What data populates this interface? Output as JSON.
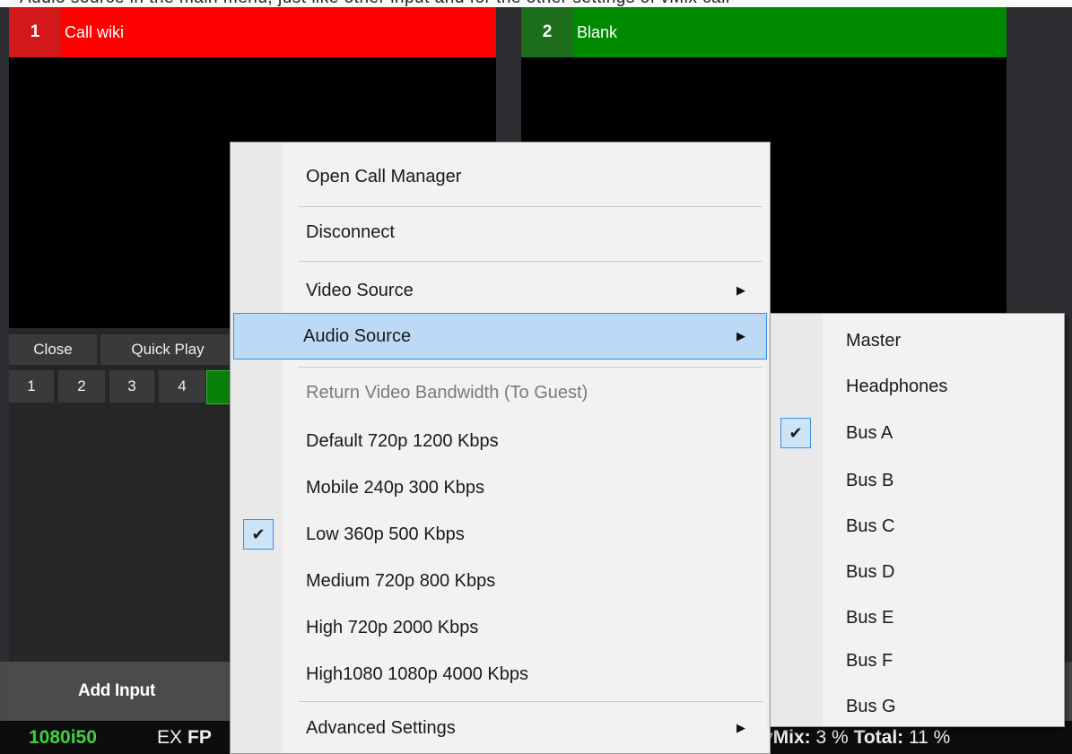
{
  "top_strip_text": "Audio source in the main menu, just like other input and for the other settings of vMix call",
  "panels": [
    {
      "number": "1",
      "title": "Call wiki",
      "color": "#fe0000"
    },
    {
      "number": "2",
      "title": "Blank",
      "color": "#008a00"
    }
  ],
  "controls": {
    "close": "Close",
    "quick_play": "Quick Play",
    "numbers": [
      "1",
      "2",
      "3",
      "4"
    ]
  },
  "bottom": {
    "add_input": "Add Input",
    "resolution": "1080i50",
    "ex": "EX",
    "fps_label": "FP",
    "vmix_label": "vMix:",
    "vmix_value": "3 %",
    "total_label": "Total:",
    "total_value": "11 %"
  },
  "context_menu": {
    "items": [
      {
        "label": "Open Call Manager"
      },
      {
        "label": "Disconnect"
      },
      {
        "label": "Video Source",
        "submenu": true
      },
      {
        "label": "Audio Source",
        "submenu": true,
        "highlighted": true
      },
      {
        "label": "Return Video Bandwidth (To Guest)",
        "disabled": true
      },
      {
        "label": "Default 720p 1200 Kbps"
      },
      {
        "label": "Mobile 240p 300 Kbps"
      },
      {
        "label": "Low 360p 500 Kbps",
        "checked": true
      },
      {
        "label": "Medium 720p 800 Kbps"
      },
      {
        "label": "High 720p 2000 Kbps"
      },
      {
        "label": "High1080 1080p 4000 Kbps"
      },
      {
        "label": "Advanced Settings",
        "submenu": true
      }
    ]
  },
  "audio_submenu": {
    "items": [
      {
        "label": "Master"
      },
      {
        "label": "Headphones"
      },
      {
        "label": "Bus A",
        "checked": true
      },
      {
        "label": "Bus B"
      },
      {
        "label": "Bus C"
      },
      {
        "label": "Bus D"
      },
      {
        "label": "Bus E"
      },
      {
        "label": "Bus F"
      },
      {
        "label": "Bus G"
      }
    ]
  },
  "icons": {
    "submenu_arrow": "arrow-right-icon",
    "check": "checkmark-icon"
  }
}
